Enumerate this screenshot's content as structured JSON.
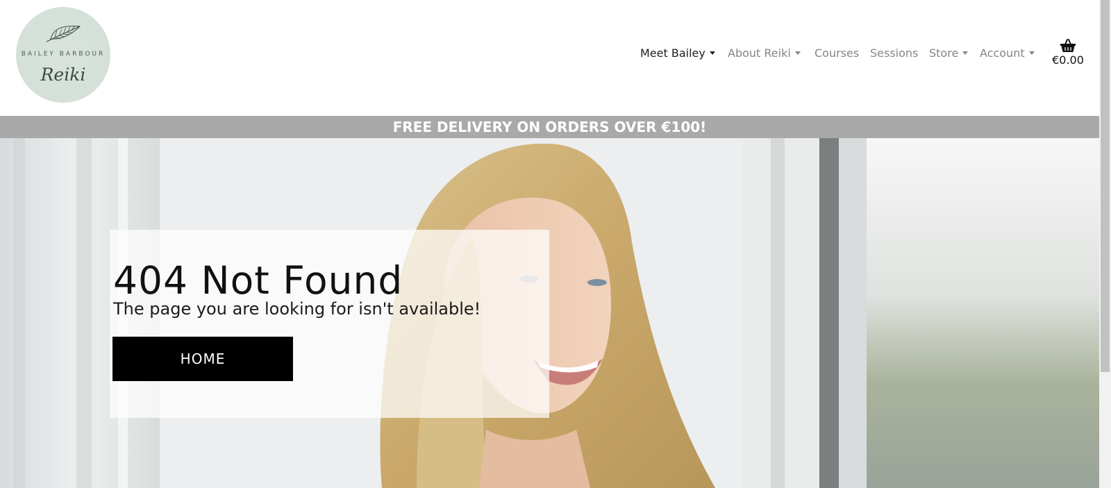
{
  "header": {
    "logo": {
      "top_text": "BAILEY BARBOUR",
      "script_text": "Reiki"
    },
    "nav": [
      {
        "label": "Meet Bailey",
        "dropdown": true,
        "active": true
      },
      {
        "label": "About Reiki",
        "dropdown": true,
        "active": false
      },
      {
        "label": "Courses",
        "dropdown": false,
        "active": false
      },
      {
        "label": "Sessions",
        "dropdown": false,
        "active": false
      },
      {
        "label": "Store",
        "dropdown": true,
        "active": false
      },
      {
        "label": "Account",
        "dropdown": true,
        "active": false
      }
    ],
    "cart": {
      "icon": "basket-icon",
      "total": "€0.00"
    }
  },
  "banner": {
    "text": "FREE DELIVERY ON ORDERS OVER €100!"
  },
  "hero": {
    "title": "404 Not Found",
    "subtitle": "The page you are looking for isn't available!",
    "button_label": "HOME"
  },
  "colors": {
    "banner_bg": "#a9a9a9",
    "button_bg": "#000000",
    "logo_bg": "#d4e0d8",
    "nav_text": "#858585",
    "nav_active": "#212121"
  }
}
